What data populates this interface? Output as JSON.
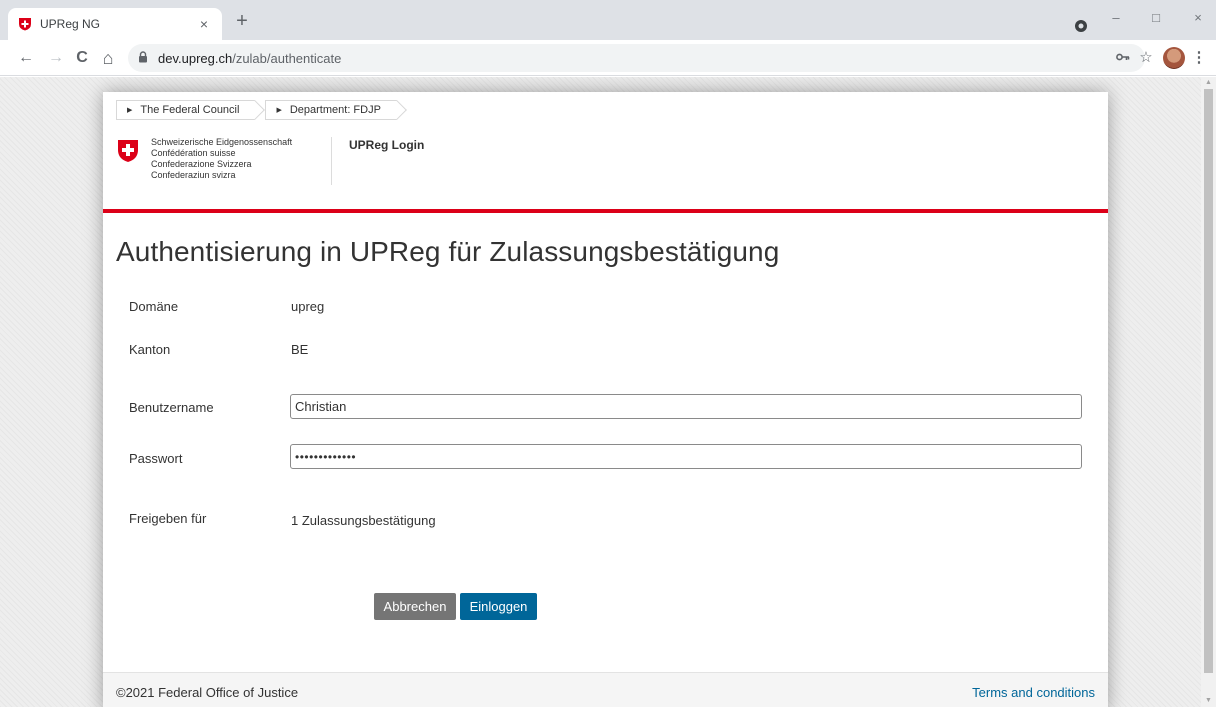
{
  "browser": {
    "tab_title": "UPReg NG",
    "tab_close": "×",
    "new_tab": "+",
    "url_host": "dev.upreg.ch",
    "url_path": "/zulab/authenticate",
    "back": "←",
    "forward": "→",
    "reload": "C",
    "home": "⌂",
    "window_minimize": "–",
    "window_maximize": "□",
    "window_close": "×",
    "menu": "⋮",
    "icons": [
      "swiss-favicon",
      "lock-icon",
      "key-icon",
      "star-icon",
      "profile-avatar",
      "kebab-menu-icon"
    ]
  },
  "breadcrumb": [
    {
      "label": "The Federal Council"
    },
    {
      "label": "Department: FDJP"
    }
  ],
  "header": {
    "confederation": [
      "Schweizerische Eidgenossenschaft",
      "Confédération suisse",
      "Confederazione Svizzera",
      "Confederaziun svizra"
    ],
    "app_title": "UPReg Login",
    "accent_color": "#dc0018"
  },
  "main": {
    "title": "Authentisierung in UPReg für Zulassungsbestätigung",
    "domain_label": "Domäne",
    "domain_value": "upreg",
    "canton_label": "Kanton",
    "canton_value": "BE",
    "username_label": "Benutzername",
    "username_value": "Christian",
    "password_label": "Passwort",
    "password_value": "•••••••••••••",
    "release_label": "Freigeben für",
    "release_value": "1 Zulassungsbestätigung",
    "cancel_button": "Abbrechen",
    "login_button": "Einloggen",
    "login_color": "#006699"
  },
  "footer": {
    "copyright": "©2021 Federal Office of Justice",
    "terms": "Terms and conditions"
  }
}
